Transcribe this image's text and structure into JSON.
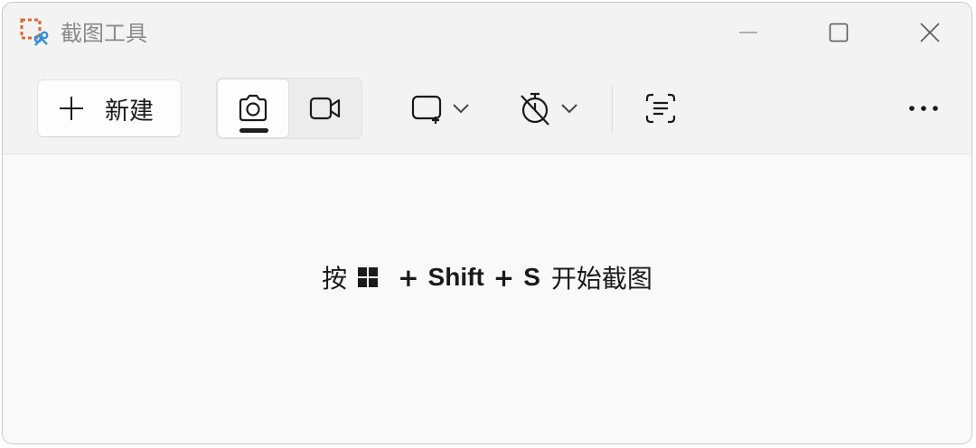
{
  "titlebar": {
    "title": "截图工具",
    "minimize_icon": "minimize-icon",
    "maximize_icon": "maximize-icon",
    "close_icon": "close-icon"
  },
  "toolbar": {
    "new_label": "新建",
    "modes": [
      {
        "name": "snip-mode",
        "icon": "camera-icon",
        "selected": true
      },
      {
        "name": "record-mode",
        "icon": "video-icon",
        "selected": false
      }
    ],
    "shape_icon": "rectangle-snip-icon",
    "delay_icon": "timer-off-icon",
    "text_actions_icon": "text-actions-icon",
    "more_icon": "more-icon"
  },
  "content": {
    "hint_prefix": "按",
    "hint_key_shift": "Shift",
    "hint_key_s": "S",
    "hint_plus": "+",
    "hint_suffix": "开始截图"
  },
  "colors": {
    "background": "#f9f9f9",
    "toolbar": "#f3f3f3",
    "text": "#1a1a1a",
    "title_text": "#8a8a8a",
    "icon_orange": "#e3662c",
    "icon_blue": "#2f8fe0"
  }
}
